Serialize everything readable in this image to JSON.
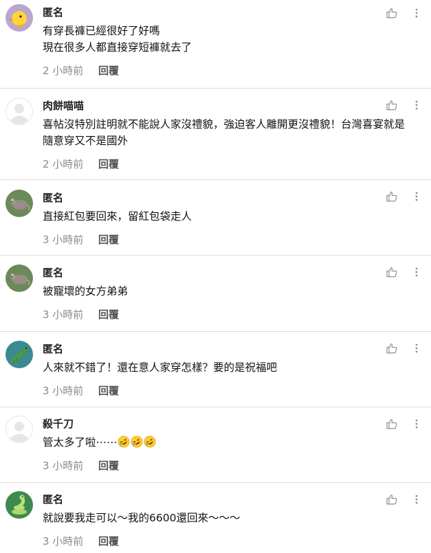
{
  "comments": [
    {
      "author": "匿名",
      "avatar": "chick-icon",
      "lines": "有穿長褲已經很好了好嗎\n現在很多人都直接穿短褲就去了",
      "time": "2 小時前",
      "reply": "回覆"
    },
    {
      "author": "肉餅喵喵",
      "avatar": "default-user-icon",
      "lines": "喜帖沒特別註明就不能說人家沒禮貌，強迫客人離開更沒禮貌！台灣喜宴就是\n隨意穿又不是國外",
      "time": "2 小時前",
      "reply": "回覆"
    },
    {
      "author": "匿名",
      "avatar": "rat-icon",
      "lines": "直接紅包要回來，留紅包袋走人",
      "time": "3 小時前",
      "reply": "回覆"
    },
    {
      "author": "匿名",
      "avatar": "rat-icon",
      "lines": "被寵壞的女方弟弟",
      "time": "3 小時前",
      "reply": "回覆"
    },
    {
      "author": "匿名",
      "avatar": "crocodile-icon",
      "lines": "人來就不錯了！還在意人家穿怎樣？要的是祝福吧",
      "time": "3 小時前",
      "reply": "回覆"
    },
    {
      "author": "殺千刀",
      "avatar": "default-user-icon",
      "lines": "管太多了啦⋯⋯",
      "emoji_count": 3,
      "time": "3 小時前",
      "reply": "回覆"
    },
    {
      "author": "匿名",
      "avatar": "snake-icon",
      "lines": "就說要我走可以～我的6600還回來～～～",
      "time": "3 小時前",
      "reply": "回覆"
    }
  ],
  "icons": {
    "like": "thumbs-up-icon",
    "more": "more-vertical-icon",
    "emoji": "rolling-on-floor-laughing-icon"
  },
  "colors": {
    "divider": "#dcdcdc",
    "time": "#8a8a8a",
    "icon": "#8f8f8f"
  }
}
